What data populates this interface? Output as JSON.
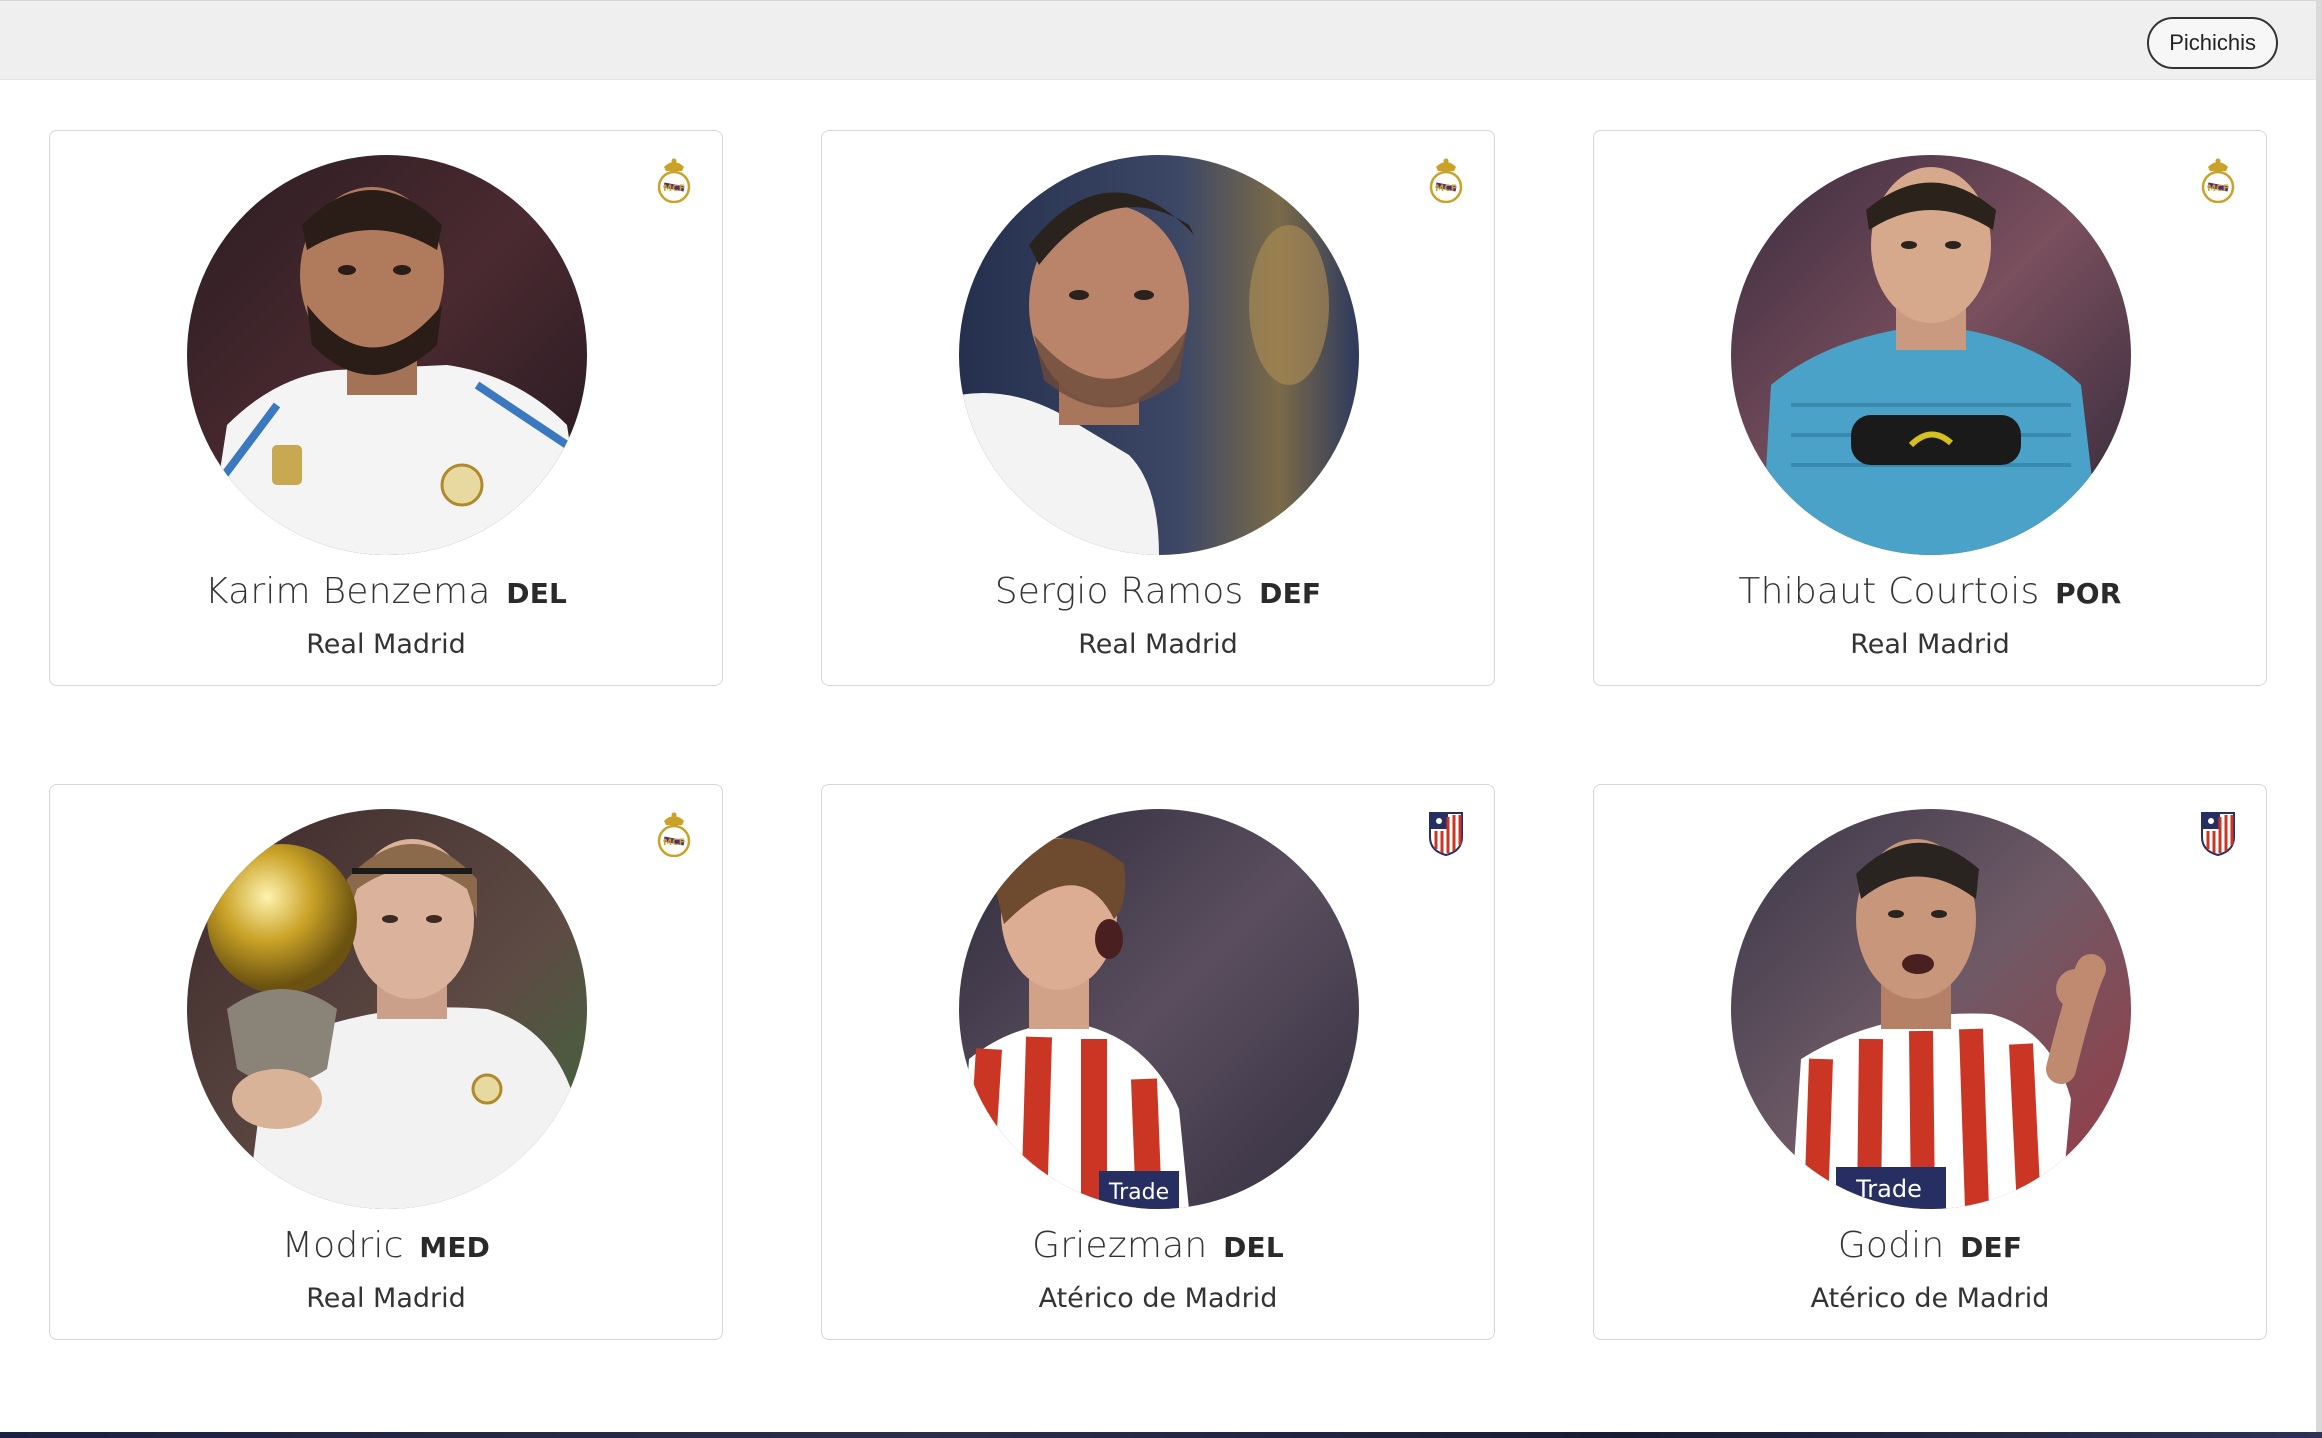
{
  "header": {
    "button_label": "Pichichis"
  },
  "players": [
    {
      "name": "Karim Benzema",
      "position": "DEL",
      "team": "Real Madrid",
      "crest": "real-madrid-crest-icon",
      "kit": "white"
    },
    {
      "name": "Sergio Ramos",
      "position": "DEF",
      "team": "Real Madrid",
      "crest": "real-madrid-crest-icon",
      "kit": "white"
    },
    {
      "name": "Thibaut Courtois",
      "position": "POR",
      "team": "Real Madrid",
      "crest": "real-madrid-crest-icon",
      "kit": "keeper-blue"
    },
    {
      "name": "Modric",
      "position": "MED",
      "team": "Real Madrid",
      "crest": "real-madrid-crest-icon",
      "kit": "white"
    },
    {
      "name": "Griezman",
      "position": "DEL",
      "team": "Atérico de Madrid",
      "crest": "atletico-madrid-crest-icon",
      "kit": "red-white-stripes"
    },
    {
      "name": "Godin",
      "position": "DEF",
      "team": "Atérico de Madrid",
      "crest": "atletico-madrid-crest-icon",
      "kit": "red-white-stripes"
    }
  ],
  "colors": {
    "header_bg": "#efefef",
    "card_border": "#d6d6d6",
    "text": "#333333",
    "real_madrid_gold": "#c9a227",
    "atletico_red": "#cb3524",
    "atletico_blue": "#272e61"
  }
}
